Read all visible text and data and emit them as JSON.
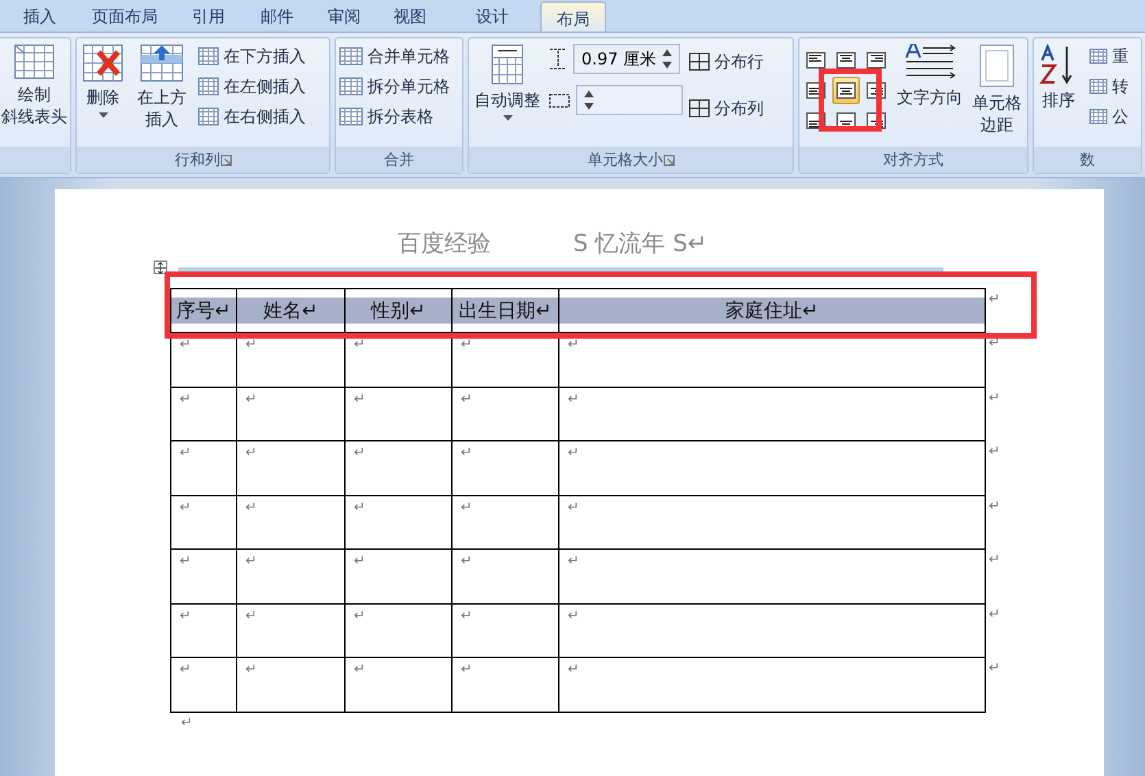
{
  "tabs": [
    {
      "label": "插入",
      "selected": false
    },
    {
      "label": "页面布局",
      "selected": false
    },
    {
      "label": "引用",
      "selected": false
    },
    {
      "label": "邮件",
      "selected": false
    },
    {
      "label": "审阅",
      "selected": false
    },
    {
      "label": "视图",
      "selected": false
    },
    {
      "label": "设计",
      "selected": false
    },
    {
      "label": "布局",
      "selected": true
    }
  ],
  "ribbon": {
    "draw": {
      "label": [
        "绘制",
        "斜线表头"
      ]
    },
    "rows_cols": {
      "title": "行和列",
      "delete": "删除",
      "insert_above": [
        "在上方",
        "插入"
      ],
      "small": [
        "在下方插入",
        "在左侧插入",
        "在右侧插入"
      ]
    },
    "merge": {
      "title": "合并",
      "items": [
        "合并单元格",
        "拆分单元格",
        "拆分表格"
      ]
    },
    "cell_size": {
      "title": "单元格大小",
      "autofit": "自动调整",
      "height_value": "0.97 厘米",
      "distribute": [
        "分布行",
        "分布列"
      ]
    },
    "alignment": {
      "title": "对齐方式",
      "cells": [
        {
          "selected": false
        },
        {
          "selected": false
        },
        {
          "selected": false
        },
        {
          "selected": false
        },
        {
          "selected": true
        },
        {
          "selected": false
        },
        {
          "selected": false
        },
        {
          "selected": false
        },
        {
          "selected": false
        }
      ],
      "text_direction": "文字方向",
      "cell_margins": [
        "单元格",
        "边距"
      ]
    },
    "data": {
      "title": "数",
      "sort": "排序",
      "small": [
        "重",
        "转",
        "公"
      ]
    }
  },
  "document": {
    "title": [
      "百度经验",
      "S 忆流年 S↵"
    ],
    "table": {
      "columns": [
        "序号↵",
        "姓名↵",
        "性别↵",
        "出生日期↵",
        "家庭住址↵"
      ],
      "rows": [
        [
          "↵",
          "↵",
          "↵",
          "↵",
          "↵"
        ],
        [
          "↵",
          "↵",
          "↵",
          "↵",
          "↵"
        ],
        [
          "↵",
          "↵",
          "↵",
          "↵",
          "↵"
        ],
        [
          "↵",
          "↵",
          "↵",
          "↵",
          "↵"
        ],
        [
          "↵",
          "↵",
          "↵",
          "↵",
          "↵"
        ],
        [
          "↵",
          "↵",
          "↵",
          "↵",
          "↵"
        ],
        [
          "↵",
          "↵",
          "↵",
          "↵",
          "↵"
        ]
      ],
      "row_end_marks": [
        "↵",
        "↵",
        "↵",
        "↵",
        "↵",
        "↵",
        "↵",
        "↵"
      ]
    },
    "after_table": "↵"
  }
}
